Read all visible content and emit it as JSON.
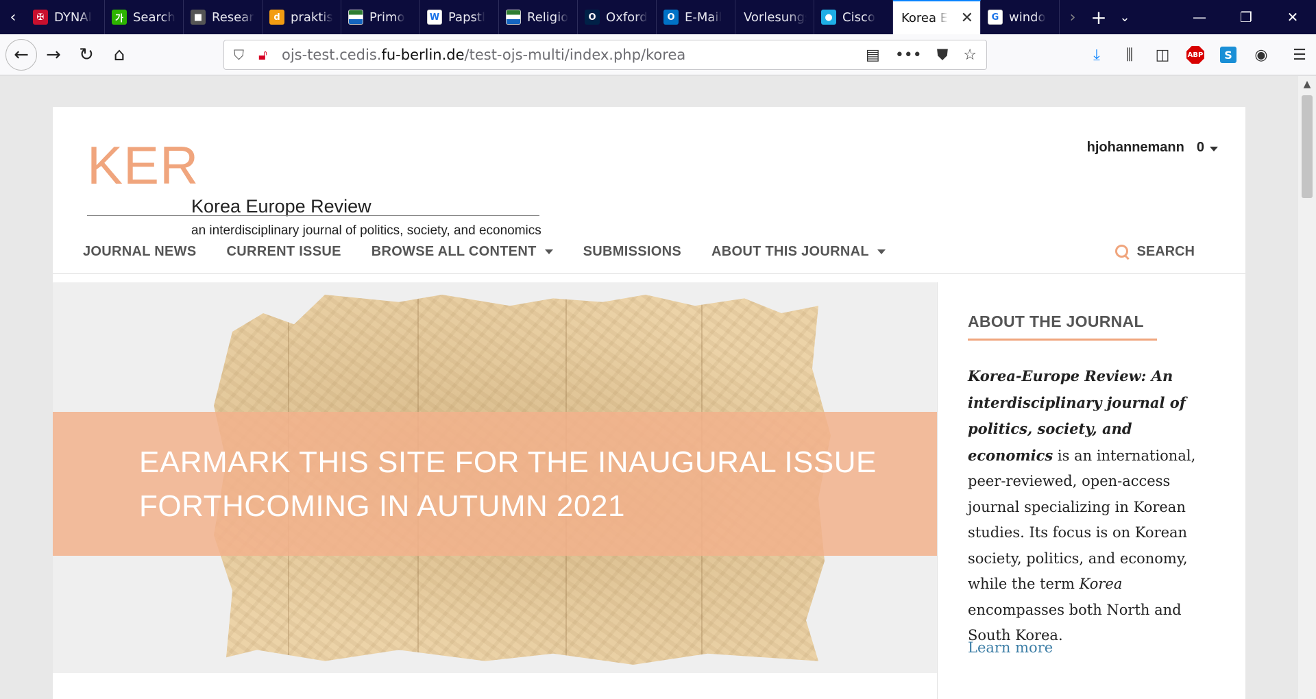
{
  "browser": {
    "tabs": [
      {
        "label": "DYNAI",
        "icon": "university-crest-icon",
        "color": "#c8102e",
        "glyph": "✠"
      },
      {
        "label": "Search",
        "icon": "korean-dictionary-icon",
        "color": "#2db400",
        "glyph": "가"
      },
      {
        "label": "Resear",
        "icon": "cube-icon",
        "color": "#555555",
        "glyph": "■"
      },
      {
        "label": "praktis",
        "icon": "d-letter-icon",
        "color": "#f39c12",
        "glyph": "d"
      },
      {
        "label": "Primo",
        "icon": "library-flag-icon",
        "color": "#f2f2f2",
        "glyph": ""
      },
      {
        "label": "Papstl",
        "icon": "wordpress-icon",
        "color": "#ffffff",
        "glyph": "W"
      },
      {
        "label": "Religio",
        "icon": "library-flag-icon",
        "color": "#f2f2f2",
        "glyph": ""
      },
      {
        "label": "Oxford",
        "icon": "oxford-icon",
        "color": "#002147",
        "glyph": "O"
      },
      {
        "label": "E-Mail",
        "icon": "outlook-icon",
        "color": "#0072c6",
        "glyph": "O"
      },
      {
        "label": "Vorlesungs",
        "icon": "",
        "color": "",
        "glyph": ""
      },
      {
        "label": "Cisco",
        "icon": "webex-icon",
        "color": "#1eaee6",
        "glyph": "●"
      },
      {
        "label": "Korea E",
        "icon": "",
        "color": "",
        "glyph": "",
        "active": true
      },
      {
        "label": "windo",
        "icon": "google-icon",
        "color": "#ffffff",
        "glyph": "G"
      }
    ],
    "url": {
      "prefix": "ojs-test.cedis.",
      "domain": "fu-berlin.de",
      "path": "/test-ojs-multi/index.php/korea"
    },
    "active_tab_close": "✕"
  },
  "header": {
    "logo_abbr": "KER",
    "logo_name": "Korea Europe Review",
    "tagline": "an interdisciplinary journal of politics, society, and economics",
    "username": "hjohannemann",
    "notifications": "0"
  },
  "nav": {
    "items": [
      {
        "label": "JOURNAL NEWS",
        "dropdown": false
      },
      {
        "label": "CURRENT ISSUE",
        "dropdown": false
      },
      {
        "label": "BROWSE ALL CONTENT",
        "dropdown": true
      },
      {
        "label": "SUBMISSIONS",
        "dropdown": false
      },
      {
        "label": "ABOUT THIS JOURNAL",
        "dropdown": true
      }
    ],
    "search_label": "SEARCH"
  },
  "hero": {
    "line1": "EARMARK THIS SITE FOR THE INAUGURAL ISSUE",
    "line2": "FORTHCOMING IN AUTUMN 2021"
  },
  "sidebar": {
    "title": "ABOUT THE JOURNAL",
    "body_bold": "Korea-Europe Review: An interdisciplinary journal of politics, society, and economics",
    "body_1": " is an international, peer-reviewed, open-access journal specializing in Korean studies. Its focus is on Korean society, politics, and economy, while the term ",
    "body_italic": "Korea",
    "body_2": " encompasses both North and South Korea.",
    "learn_more": "Learn more"
  },
  "colors": {
    "accent": "#f0a57d",
    "link": "#3d7ea6",
    "tabstrip": "#0c0c3c"
  }
}
